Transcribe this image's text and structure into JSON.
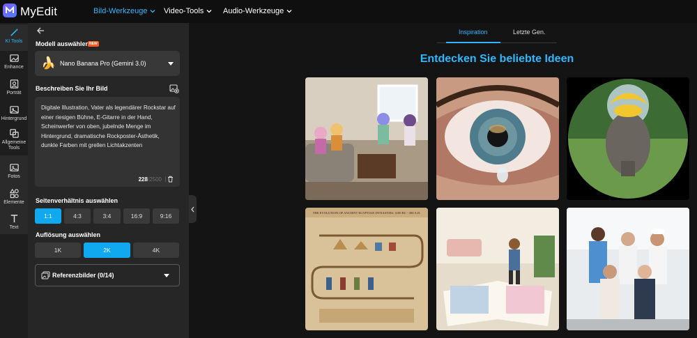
{
  "app": {
    "name": "MyEdit"
  },
  "nav": [
    {
      "label": "Bild-Werkzeuge",
      "active": true
    },
    {
      "label": "Video-Tools",
      "active": false
    },
    {
      "label": "Audio-Werkzeuge",
      "active": false
    }
  ],
  "rail": [
    {
      "label": "KI Tools",
      "icon": "magic-wand-icon",
      "active": true
    },
    {
      "label": "Enhance",
      "icon": "enhance-icon"
    },
    {
      "label": "Porträt",
      "icon": "portrait-icon"
    },
    {
      "label": "Hintergrund",
      "icon": "background-icon"
    },
    {
      "label": "Allgemeine Tools",
      "icon": "tools-icon"
    },
    {
      "label": "Fotos",
      "icon": "photos-icon"
    },
    {
      "label": "Elemente",
      "icon": "elements-icon"
    },
    {
      "label": "Text",
      "icon": "text-icon"
    }
  ],
  "panel": {
    "model_title": "Modell auswählen",
    "model_badge": "NEW",
    "model_emoji": "🍌",
    "model_name": "Nano Banana Pro (Gemini 3.0)",
    "prompt_title": "Beschreiben Sie Ihr Bild",
    "prompt_text": "Digitale Illustration, Vater als legendärer Rockstar auf einer riesigen Bühne, E-Gitarre in der Hand, Scheinwerfer von oben, jubelnde Menge im Hintergrund, dramatische Rockposter-Ästhetik, dunkle Farben mit grellen Lichtakzenten",
    "char_count": "228",
    "char_max": "/2500",
    "ratio_title": "Seitenverhältnis auswählen",
    "ratios": [
      "1:1",
      "4:3",
      "3:4",
      "16:9",
      "9:16"
    ],
    "ratio_selected": "1:1",
    "resolution_title": "Auflösung auswählen",
    "resolutions": [
      "1K",
      "2K",
      "4K"
    ],
    "resolution_selected": "2K",
    "reference_label": "Referenzbilder (0/14)"
  },
  "main": {
    "tabs": [
      {
        "label": "Inspiration",
        "active": true
      },
      {
        "label": "Letzte Gen.",
        "active": false
      }
    ],
    "heading": "Entdecken Sie beliebte Ideen",
    "gallery": [
      {
        "name": "living-room-girls-image"
      },
      {
        "name": "eye-tear-image"
      },
      {
        "name": "fisheye-elephant-image"
      },
      {
        "name": "egypt-timeline-image",
        "caption": "THE EVOLUTION OF ANCIENT EGYPTIAN DYNASTIES: 3100 BC - 300 A.D."
      },
      {
        "name": "storybook-girl-image"
      },
      {
        "name": "professionals-group-image"
      }
    ]
  },
  "colors": {
    "accent": "#2fb7ff",
    "selected": "#10a8ef",
    "badge": "#ff5a1f",
    "panel": "#262626",
    "background": "#141414"
  }
}
